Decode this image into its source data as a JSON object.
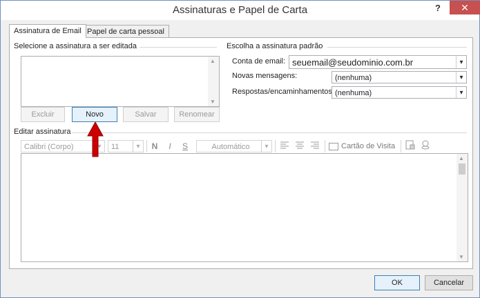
{
  "window": {
    "title": "Assinaturas e Papel de Carta",
    "help_glyph": "?",
    "close_glyph": "✕"
  },
  "tabs": [
    {
      "label": "Assinatura de Email",
      "active": true
    },
    {
      "label": "Papel de carta pessoal",
      "active": false
    }
  ],
  "select_group": {
    "label": "Selecione a assinatura a ser editada",
    "buttons": {
      "delete": "Excluir",
      "new": "Novo",
      "save": "Salvar",
      "rename": "Renomear"
    }
  },
  "default_group": {
    "label": "Escolha a assinatura padrão",
    "email_label": "Conta de email:",
    "email_value": "seuemail@seudominio.com.br",
    "new_label": "Novas mensagens:",
    "new_value": "(nenhuma)",
    "replies_label": "Respostas/encaminhamentos:",
    "replies_value": "(nenhuma)"
  },
  "edit_group": {
    "label": "Editar assinatura",
    "font": "Calibri (Corpo)",
    "size": "11",
    "bold": "N",
    "italic": "I",
    "underline": "S",
    "color": "Automático",
    "business_card": "Cartão de Visita"
  },
  "footer": {
    "ok": "OK",
    "cancel": "Cancelar"
  },
  "colors": {
    "accent_arrow": "#cc0000",
    "close_bg": "#c75050",
    "focus_border": "#3c7fb1"
  }
}
